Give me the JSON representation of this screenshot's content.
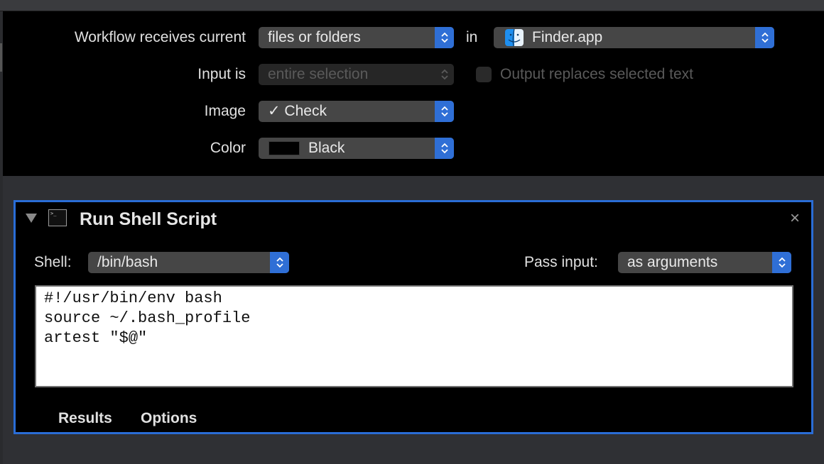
{
  "workflow": {
    "receives_label": "Workflow receives current",
    "receives_value": "files or folders",
    "in_label": "in",
    "app_value": "Finder.app",
    "input_is_label": "Input is",
    "input_is_value": "entire selection",
    "output_replaces_label": "Output replaces selected text",
    "output_replaces_checked": false,
    "image_label": "Image",
    "image_value": "✓ Check",
    "color_label": "Color",
    "color_value": "Black",
    "color_swatch": "#000000"
  },
  "action": {
    "title": "Run Shell Script",
    "shell_label": "Shell:",
    "shell_value": "/bin/bash",
    "pass_input_label": "Pass input:",
    "pass_input_value": "as arguments",
    "script": "#!/usr/bin/env bash\nsource ~/.bash_profile\nartest \"$@\"",
    "tabs": [
      {
        "label": "Results"
      },
      {
        "label": "Options"
      }
    ],
    "close_glyph": "×",
    "terminal_glyph": ">_"
  },
  "colors": {
    "accent": "#2a6dd6",
    "background": "#000000",
    "chrome": "#2f3034"
  }
}
